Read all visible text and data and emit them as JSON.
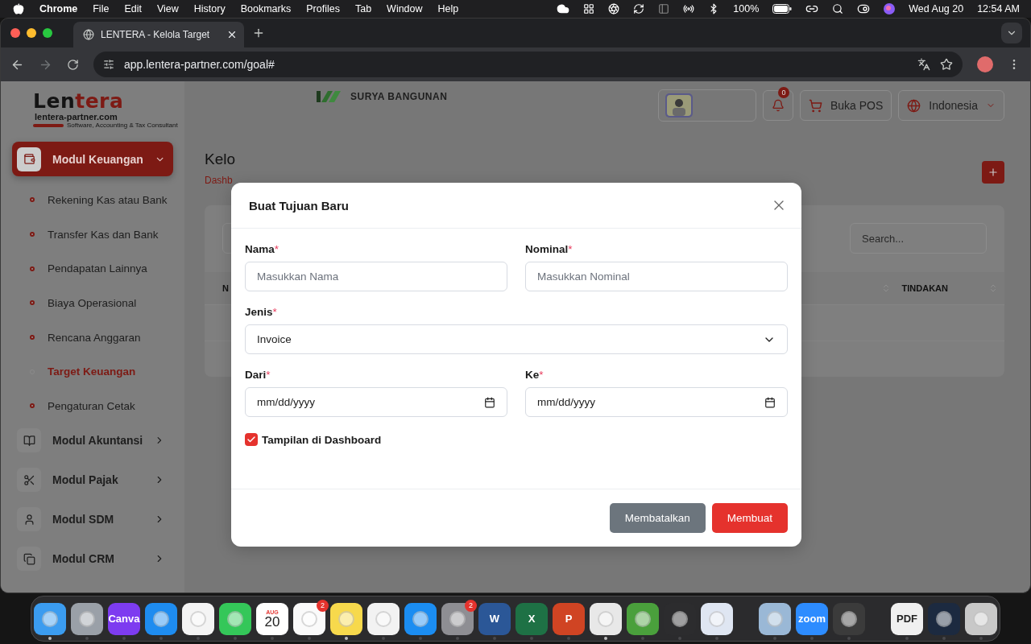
{
  "menu_bar": {
    "app": "Chrome",
    "menus": [
      "File",
      "Edit",
      "View",
      "History",
      "Bookmarks",
      "Profiles",
      "Tab",
      "Window",
      "Help"
    ],
    "battery": "100%",
    "date": "Wed Aug 20",
    "time": "12:54 AM"
  },
  "browser": {
    "tabs": [
      {
        "title": "LENTERA - Kelola Target",
        "selected": true
      }
    ],
    "url": "app.lentera-partner.com/goal#"
  },
  "sidebar": {
    "logo": {
      "dark": "Len",
      "red": "tera",
      "site": "lentera-partner.com",
      "tagline": "Software, Accounting & Tax Consultant"
    },
    "modules": [
      {
        "label": "Modul Keuangan",
        "expanded": true,
        "children": [
          {
            "label": "Rekening Kas atau Bank",
            "selected": false
          },
          {
            "label": "Transfer Kas dan Bank",
            "selected": false
          },
          {
            "label": "Pendapatan Lainnya",
            "selected": false
          },
          {
            "label": "Biaya Operasional",
            "selected": false
          },
          {
            "label": "Rencana Anggaran",
            "selected": false
          },
          {
            "label": "Target Keuangan",
            "selected": true
          },
          {
            "label": "Pengaturan Cetak",
            "selected": false
          }
        ]
      },
      {
        "label": "Modul Akuntansi",
        "expanded": false
      },
      {
        "label": "Modul Pajak",
        "expanded": false
      },
      {
        "label": "Modul SDM",
        "expanded": false
      },
      {
        "label": "Modul CRM",
        "expanded": false
      }
    ]
  },
  "header": {
    "company": "SURYA BANGUNAN",
    "notifications": "0",
    "pos_button": "Buka POS",
    "language": "Indonesia"
  },
  "page": {
    "title": "Kelo",
    "breadcrumb": "Dashb"
  },
  "table": {
    "search": {
      "placeholder": "Search..."
    },
    "columns": [
      {
        "label": "N"
      },
      {
        "label": "TINDAKAN"
      }
    ]
  },
  "modal": {
    "title": "Buat Tujuan Baru",
    "fields": [
      {
        "kind": "text",
        "label": "Nama",
        "mark": "*",
        "placeholder": "Masukkan Nama"
      },
      {
        "kind": "text",
        "label": "Nominal",
        "mark": "*",
        "placeholder": "Masukkan Nominal"
      },
      {
        "kind": "select",
        "label": "Jenis",
        "mark": "*",
        "value": "Invoice"
      },
      {
        "kind": "date",
        "label": "Dari",
        "mark": "*",
        "placeholder": "mm/dd/yyyy"
      },
      {
        "kind": "date",
        "label": "Ke",
        "mark": "*",
        "placeholder": "mm/dd/yyyy"
      }
    ],
    "checkbox": {
      "label": "Tampilan di Dashboard",
      "checked": true
    },
    "buttons": [
      {
        "label": "Membatalkan",
        "kind": "secondary"
      },
      {
        "label": "Membuat",
        "kind": "primary"
      }
    ]
  },
  "dock": {
    "groups": [
      [
        {
          "color": "#3b9cf0",
          "running": true
        },
        {
          "color": "#9aa0a8",
          "running": false
        },
        {
          "color": "#7d3cf0",
          "label": "Canva",
          "running": false
        },
        {
          "color": "#1e8cf0",
          "running": false
        },
        {
          "color": "#f4f4f4",
          "running": false
        },
        {
          "color": "#34c759",
          "running": false
        },
        {
          "color": "#ffffff",
          "label": "AUG",
          "sublabel": "20",
          "running": false
        },
        {
          "color": "#fafafa",
          "badge": "2",
          "running": false
        },
        {
          "color": "#f7d94c",
          "running": true
        },
        {
          "color": "#f2f2f2",
          "running": false
        },
        {
          "color": "#1b8df2",
          "running": false
        },
        {
          "color": "#8e8e93",
          "badge": "2",
          "running": false
        },
        {
          "color": "#2b5797",
          "label": "W",
          "running": false
        },
        {
          "color": "#1e7145",
          "label": "X",
          "running": false
        },
        {
          "color": "#d04423",
          "label": "P",
          "running": false
        },
        {
          "color": "#e8e8e8",
          "running": true
        },
        {
          "color": "#4aa03c",
          "running": false
        },
        {
          "color": "#2c2c2e",
          "running": false
        },
        {
          "color": "#dfe6f2",
          "running": false
        }
      ],
      [
        {
          "color": "#9ab8d6",
          "running": false
        },
        {
          "color": "#2d8cff",
          "label": "zoom",
          "running": false
        },
        {
          "color": "#3b3b3b",
          "running": false
        }
      ],
      [
        {
          "color": "#f0f0f0",
          "label": "PDF",
          "running": false
        },
        {
          "color": "#1c2a40",
          "running": false
        },
        {
          "color": "#c8c8c8",
          "running": false
        }
      ]
    ]
  }
}
